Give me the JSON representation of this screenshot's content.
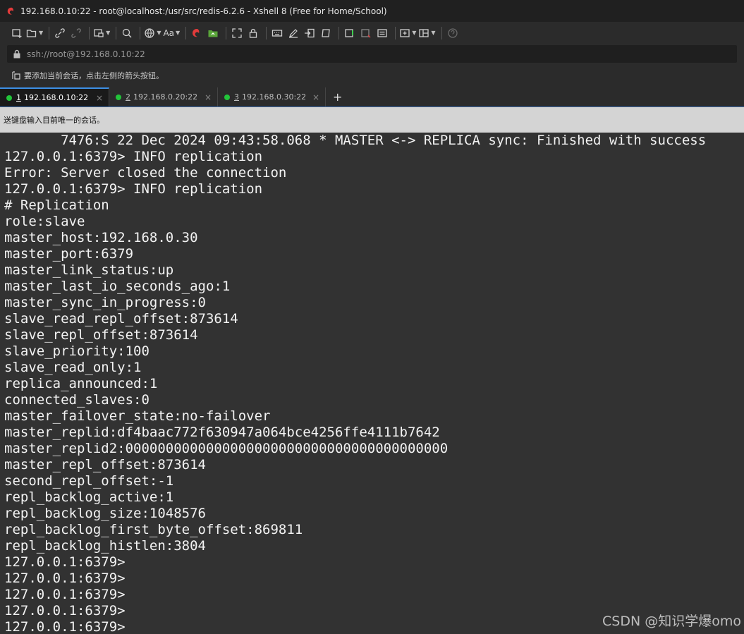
{
  "window": {
    "title": "192.168.0.10:22 - root@localhost:/usr/src/redis-6.2.6 - Xshell 8 (Free for Home/School)"
  },
  "toolbar": {
    "icons": [
      "new-session-icon",
      "open-folder-icon",
      "link-icon",
      "unlink-icon",
      "layout-icon",
      "search-icon",
      "globe-icon",
      "font-icon",
      "xshell-logo-icon",
      "xftp-icon",
      "fullscreen-icon",
      "lock-icon",
      "keyboard-icon",
      "pen-icon",
      "transfer-icon",
      "script-icon",
      "compose-icon",
      "layout2-icon",
      "layout3-icon",
      "split-icon",
      "help-icon"
    ],
    "font_label": "Aa"
  },
  "address": {
    "value": "ssh://root@192.168.0.10:22"
  },
  "hint": {
    "text": "要添加当前会话，点击左侧的箭头按钮。"
  },
  "tabs": [
    {
      "num": "1",
      "label": "192.168.0.10:22",
      "active": true
    },
    {
      "num": "2",
      "label": "192.168.0.20:22",
      "active": false
    },
    {
      "num": "3",
      "label": "192.168.0.30:22",
      "active": false
    }
  ],
  "tab_add_label": "+",
  "tab_close_label": "×",
  "notice": {
    "text": "送键盘输入目前唯一的会话。"
  },
  "terminal": {
    "lines": [
      "       7476:S 22 Dec 2024 09:43:58.068 * MASTER <-> REPLICA sync: Finished with success",
      "127.0.0.1:6379> INFO replication",
      "Error: Server closed the connection",
      "127.0.0.1:6379> INFO replication",
      "# Replication",
      "role:slave",
      "master_host:192.168.0.30",
      "master_port:6379",
      "master_link_status:up",
      "master_last_io_seconds_ago:1",
      "master_sync_in_progress:0",
      "slave_read_repl_offset:873614",
      "slave_repl_offset:873614",
      "slave_priority:100",
      "slave_read_only:1",
      "replica_announced:1",
      "connected_slaves:0",
      "master_failover_state:no-failover",
      "master_replid:df4baac772f630947a064bce4256ffe4111b7642",
      "master_replid2:0000000000000000000000000000000000000000",
      "master_repl_offset:873614",
      "second_repl_offset:-1",
      "repl_backlog_active:1",
      "repl_backlog_size:1048576",
      "repl_backlog_first_byte_offset:869811",
      "repl_backlog_histlen:3804",
      "127.0.0.1:6379>",
      "127.0.0.1:6379>",
      "127.0.0.1:6379>",
      "127.0.0.1:6379>",
      "127.0.0.1:6379>"
    ]
  },
  "watermark": "CSDN @知识学爆omo"
}
